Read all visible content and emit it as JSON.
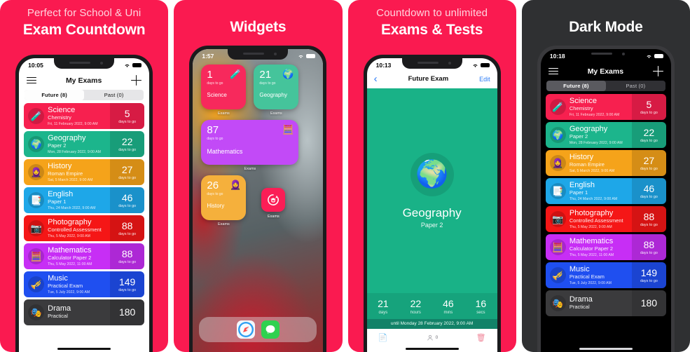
{
  "panels": [
    {
      "caption_sub": "Perfect for School & Uni",
      "caption_main": "Exam Countdown",
      "status_time": "10:05",
      "nav_title": "My Exams",
      "tab_future": "Future  (8)",
      "tab_past": "Past  (0)"
    },
    {
      "caption_main": "Widgets",
      "status_time": "1:57"
    },
    {
      "caption_sub": "Countdown to unlimited",
      "caption_main": "Exams & Tests",
      "status_time": "10:13",
      "nav_back": "‹",
      "nav_title": "Future Exam",
      "nav_edit": "Edit"
    },
    {
      "caption_main": "Dark Mode",
      "status_time": "10:18",
      "nav_title": "My Exams",
      "tab_future": "Future  (8)",
      "tab_past": "Past  (0)"
    }
  ],
  "exams": [
    {
      "title": "Science",
      "sub": "Chemistry",
      "date": "Fri, 11 February 2022, 9:00 AM",
      "days": "5",
      "unit": "days to go",
      "color": "#f7204f",
      "icon": "🧪"
    },
    {
      "title": "Geography",
      "sub": "Paper 2",
      "date": "Mon, 28 February 2022, 9:00 AM",
      "days": "22",
      "unit": "days to go",
      "color": "#1cb58c",
      "icon": "🌍"
    },
    {
      "title": "History",
      "sub": "Roman Empire",
      "date": "Sat, 5 March 2022, 9:00 AM",
      "days": "27",
      "unit": "days to go",
      "color": "#f5a31a",
      "icon": "🧕"
    },
    {
      "title": "English",
      "sub": "Paper 1",
      "date": "Thu, 24 March 2022, 9:00 AM",
      "days": "46",
      "unit": "days to go",
      "color": "#1ea7e8",
      "icon": "📑"
    },
    {
      "title": "Photography",
      "sub": "Controlled Assessment",
      "date": "Thu, 5 May 2022, 9:00 AM",
      "days": "88",
      "unit": "days to go",
      "color": "#f51616",
      "icon": "📷"
    },
    {
      "title": "Mathematics",
      "sub": "Calculator Paper 2",
      "date": "Thu, 5 May 2022, 11:00 AM",
      "days": "88",
      "unit": "days to go",
      "color": "#c72ef5",
      "icon": "🧮"
    },
    {
      "title": "Music",
      "sub": "Practical Exam",
      "date": "Tue, 5 July 2022, 9:00 AM",
      "days": "149",
      "unit": "days to go",
      "color": "#1f4ff0",
      "icon": "🎺"
    },
    {
      "title": "Drama",
      "sub": "Practical",
      "date": "",
      "days": "180",
      "unit": "",
      "color": "#3b3b3d",
      "icon": "🎭"
    }
  ],
  "widgets": {
    "label": "Exams",
    "dtg": "days to go",
    "items": [
      {
        "days": "1",
        "name": "Science",
        "color": "#f7295c",
        "icon": "🧪",
        "size": "small"
      },
      {
        "days": "21",
        "name": "Geography",
        "color": "#45c49b",
        "icon": "🌍",
        "size": "small"
      },
      {
        "days": "87",
        "name": "Mathematics",
        "color": "#c24af7",
        "icon": "🧮",
        "size": "large"
      },
      {
        "days": "26",
        "name": "History",
        "color": "#f5b03c",
        "icon": "🧕",
        "size": "small"
      }
    ],
    "app_label": "Exams",
    "dock": [
      "safari-icon",
      "messages-icon"
    ]
  },
  "detail": {
    "icon": "🌍",
    "title": "Geography",
    "subtitle": "Paper 2",
    "countdown": [
      {
        "value": "21",
        "label": "days"
      },
      {
        "value": "22",
        "label": "hours"
      },
      {
        "value": "46",
        "label": "mins"
      },
      {
        "value": "16",
        "label": "secs"
      }
    ],
    "until": "until Monday 28 February 2022, 9:00 AM",
    "notes_icon": "📄",
    "people_count": "0",
    "trash_icon": "🗑"
  },
  "colors": {
    "brand_pink": "#fa1a50",
    "dark_bg": "#2f3032",
    "accent_blue": "#2e7df6",
    "detail_green": "#19b287"
  }
}
